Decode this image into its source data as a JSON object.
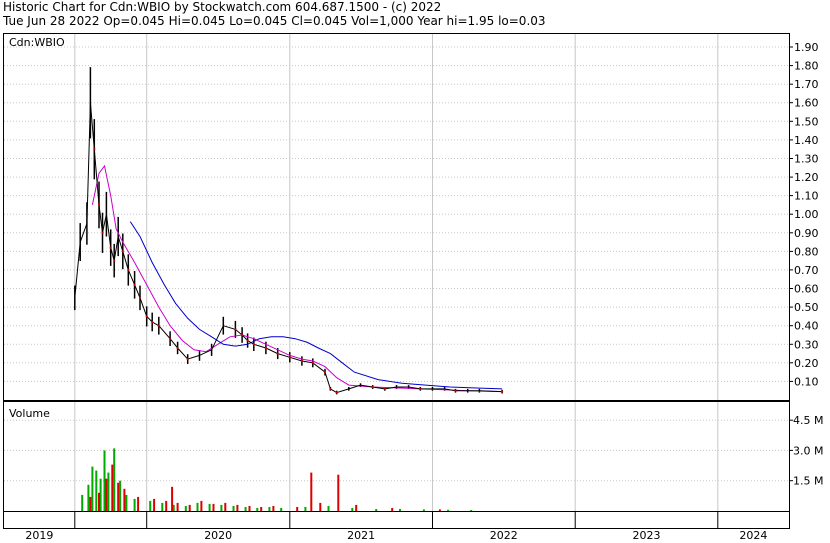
{
  "header": {
    "line1": "Historic Chart for Cdn:WBIO by Stockwatch.com 604.687.1500 - (c) 2022",
    "line2": "Tue Jun 28 2022  Op=0.045  Hi=0.045  Lo=0.045  Cl=0.045  Vol=1,000  Year hi=1.95  lo=0.03"
  },
  "colors": {
    "price": "#000000",
    "down_marker": "#cc0000",
    "ma_short": "#cc00cc",
    "ma_long": "#0000cc",
    "vol_up": "#00aa00",
    "vol_down": "#dd0000",
    "grid": "#c8c8c8"
  },
  "chart_data": [
    {
      "type": "line",
      "panel": "price",
      "label": "Cdn:WBIO",
      "y_ticks": [
        "1.90",
        "1.80",
        "1.70",
        "1.60",
        "1.50",
        "1.40",
        "1.30",
        "1.20",
        "1.10",
        "1.00",
        "0.90",
        "0.80",
        "0.70",
        "0.60",
        "0.50",
        "0.40",
        "0.30",
        "0.20",
        "0.10"
      ],
      "ylim": [
        0,
        1.97
      ],
      "xlim": [
        "2019-01-01",
        "2024-07-01"
      ],
      "grid": true,
      "series": [
        {
          "role": "close",
          "x": [
            "2019-07-01",
            "2019-07-15",
            "2019-08-01",
            "2019-08-10",
            "2019-08-20",
            "2019-09-01",
            "2019-09-10",
            "2019-09-20",
            "2019-10-01",
            "2019-10-10",
            "2019-10-20",
            "2019-11-01",
            "2019-11-15",
            "2019-12-01",
            "2019-12-15",
            "2020-01-01",
            "2020-01-15",
            "2020-02-01",
            "2020-03-01",
            "2020-03-20",
            "2020-04-15",
            "2020-05-15",
            "2020-06-15",
            "2020-07-15",
            "2020-08-15",
            "2020-09-01",
            "2020-09-15",
            "2020-10-01",
            "2020-11-01",
            "2020-12-01",
            "2021-01-01",
            "2021-02-01",
            "2021-03-01",
            "2021-04-01",
            "2021-04-15",
            "2021-05-01",
            "2021-06-01",
            "2021-07-01",
            "2021-08-01",
            "2021-09-01",
            "2021-10-01",
            "2021-11-01",
            "2021-12-01",
            "2022-01-01",
            "2022-02-01",
            "2022-03-01",
            "2022-04-01",
            "2022-05-01",
            "2022-06-28"
          ],
          "y": [
            0.55,
            0.85,
            0.95,
            1.6,
            1.35,
            1.05,
            0.9,
            1.0,
            0.82,
            0.75,
            0.88,
            0.8,
            0.7,
            0.62,
            0.55,
            0.45,
            0.42,
            0.4,
            0.33,
            0.28,
            0.22,
            0.24,
            0.27,
            0.4,
            0.38,
            0.35,
            0.32,
            0.3,
            0.28,
            0.25,
            0.23,
            0.21,
            0.2,
            0.15,
            0.06,
            0.04,
            0.06,
            0.08,
            0.07,
            0.06,
            0.07,
            0.07,
            0.06,
            0.06,
            0.06,
            0.05,
            0.05,
            0.05,
            0.045
          ]
        },
        {
          "role": "ma_short",
          "x": [
            "2019-08-15",
            "2019-09-01",
            "2019-09-15",
            "2019-10-01",
            "2019-10-15",
            "2019-11-01",
            "2019-12-01",
            "2020-01-01",
            "2020-02-01",
            "2020-03-01",
            "2020-04-01",
            "2020-05-01",
            "2020-06-01",
            "2020-07-01",
            "2020-08-01",
            "2020-09-01",
            "2020-10-01",
            "2020-11-01",
            "2020-12-01",
            "2021-01-01",
            "2021-02-01",
            "2021-03-01",
            "2021-04-01",
            "2021-05-01",
            "2021-06-01",
            "2021-08-01",
            "2021-10-01",
            "2021-12-01",
            "2022-02-01",
            "2022-04-01",
            "2022-06-28"
          ],
          "y": [
            1.05,
            1.22,
            1.26,
            1.1,
            0.92,
            0.85,
            0.74,
            0.62,
            0.5,
            0.4,
            0.32,
            0.27,
            0.26,
            0.3,
            0.34,
            0.35,
            0.33,
            0.3,
            0.27,
            0.24,
            0.22,
            0.21,
            0.18,
            0.12,
            0.08,
            0.07,
            0.065,
            0.06,
            0.055,
            0.05,
            0.045
          ]
        },
        {
          "role": "ma_long",
          "x": [
            "2019-11-20",
            "2019-12-15",
            "2020-01-15",
            "2020-02-15",
            "2020-03-15",
            "2020-04-15",
            "2020-05-15",
            "2020-06-15",
            "2020-07-15",
            "2020-08-15",
            "2020-09-15",
            "2020-10-15",
            "2020-11-15",
            "2020-12-15",
            "2021-01-15",
            "2021-02-15",
            "2021-03-15",
            "2021-04-15",
            "2021-05-15",
            "2021-06-15",
            "2021-08-15",
            "2021-10-15",
            "2021-12-15",
            "2022-02-15",
            "2022-04-15",
            "2022-06-28"
          ],
          "y": [
            0.96,
            0.88,
            0.74,
            0.62,
            0.52,
            0.44,
            0.38,
            0.34,
            0.3,
            0.29,
            0.3,
            0.33,
            0.34,
            0.34,
            0.33,
            0.31,
            0.28,
            0.25,
            0.2,
            0.15,
            0.11,
            0.09,
            0.08,
            0.07,
            0.065,
            0.06
          ]
        }
      ]
    },
    {
      "type": "bar",
      "panel": "volume",
      "label": "Volume",
      "y_ticks": [
        "4.5 M",
        "3.0 M",
        "1.5 M"
      ],
      "ylim": [
        0,
        5400000
      ],
      "xlim": [
        "2019-01-01",
        "2024-07-01"
      ],
      "x_labels": [
        "2019",
        "2020",
        "2021",
        "2022",
        "2023",
        "2024"
      ],
      "x_boundaries": [
        "2019-07-01",
        "2020-01-01",
        "2021-01-01",
        "2022-01-01",
        "2023-01-01",
        "2024-01-01"
      ],
      "series": [
        {
          "name": "up",
          "x": [
            "2019-07-20",
            "2019-08-05",
            "2019-08-15",
            "2019-08-25",
            "2019-09-05",
            "2019-09-15",
            "2019-09-25",
            "2019-10-10",
            "2019-10-25",
            "2019-11-10",
            "2019-12-01",
            "2020-01-10",
            "2020-02-10",
            "2020-03-10",
            "2020-04-10",
            "2020-05-10",
            "2020-06-10",
            "2020-07-10",
            "2020-08-10",
            "2020-09-10",
            "2020-10-10",
            "2020-11-10",
            "2020-12-10",
            "2021-02-10",
            "2021-04-10",
            "2021-06-10",
            "2021-08-10",
            "2021-10-10",
            "2021-12-10",
            "2022-02-10",
            "2022-04-10"
          ],
          "y": [
            800000,
            1300000,
            2200000,
            2000000,
            1600000,
            3000000,
            1900000,
            3100000,
            1500000,
            800000,
            600000,
            500000,
            400000,
            300000,
            250000,
            400000,
            350000,
            300000,
            250000,
            200000,
            150000,
            200000,
            150000,
            200000,
            250000,
            150000,
            100000,
            100000,
            80000,
            60000,
            50000
          ]
        },
        {
          "name": "down",
          "x": [
            "2019-08-10",
            "2019-09-01",
            "2019-09-20",
            "2019-10-05",
            "2019-10-20",
            "2019-11-05",
            "2019-12-10",
            "2020-01-20",
            "2020-02-20",
            "2020-03-06",
            "2020-03-20",
            "2020-04-20",
            "2020-05-20",
            "2020-06-20",
            "2020-07-20",
            "2020-08-20",
            "2020-09-20",
            "2020-10-20",
            "2020-11-20",
            "2021-01-20",
            "2021-02-25",
            "2021-03-20",
            "2021-05-05",
            "2021-06-20",
            "2021-09-20",
            "2022-01-20"
          ],
          "y": [
            700000,
            900000,
            1600000,
            2300000,
            1400000,
            1100000,
            700000,
            600000,
            500000,
            1200000,
            400000,
            300000,
            500000,
            350000,
            400000,
            300000,
            250000,
            200000,
            250000,
            200000,
            1900000,
            400000,
            1800000,
            300000,
            150000,
            80000
          ]
        }
      ]
    }
  ]
}
